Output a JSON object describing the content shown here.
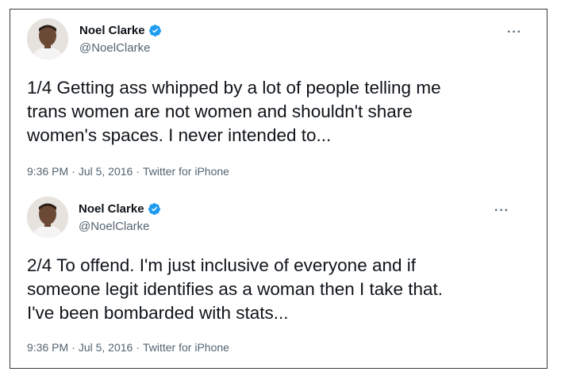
{
  "tweets": [
    {
      "name": "Noel Clarke",
      "handle": "@NoelClarke",
      "text": "1/4 Getting ass whipped by a lot of people telling me\ntrans women are not women and shouldn't share\nwomen's spaces. I never intended to...",
      "time": "9:36 PM",
      "date": "Jul 5, 2016",
      "source": "Twitter for iPhone",
      "separator": "·",
      "more": "···"
    },
    {
      "name": "Noel Clarke",
      "handle": "@NoelClarke",
      "text": "2/4 To offend. I'm just inclusive of everyone and if\nsomeone legit identifies as a woman then I take that.\nI've been bombarded with stats...",
      "time": "9:36 PM",
      "date": "Jul 5, 2016",
      "source": "Twitter for iPhone",
      "separator": "·",
      "more": "···"
    }
  ],
  "colors": {
    "verified": "#1d9bf0",
    "secondary": "#536471",
    "text": "#0f1419"
  },
  "icons": {
    "verified": "verified-badge-icon",
    "more": "more-options-icon"
  }
}
